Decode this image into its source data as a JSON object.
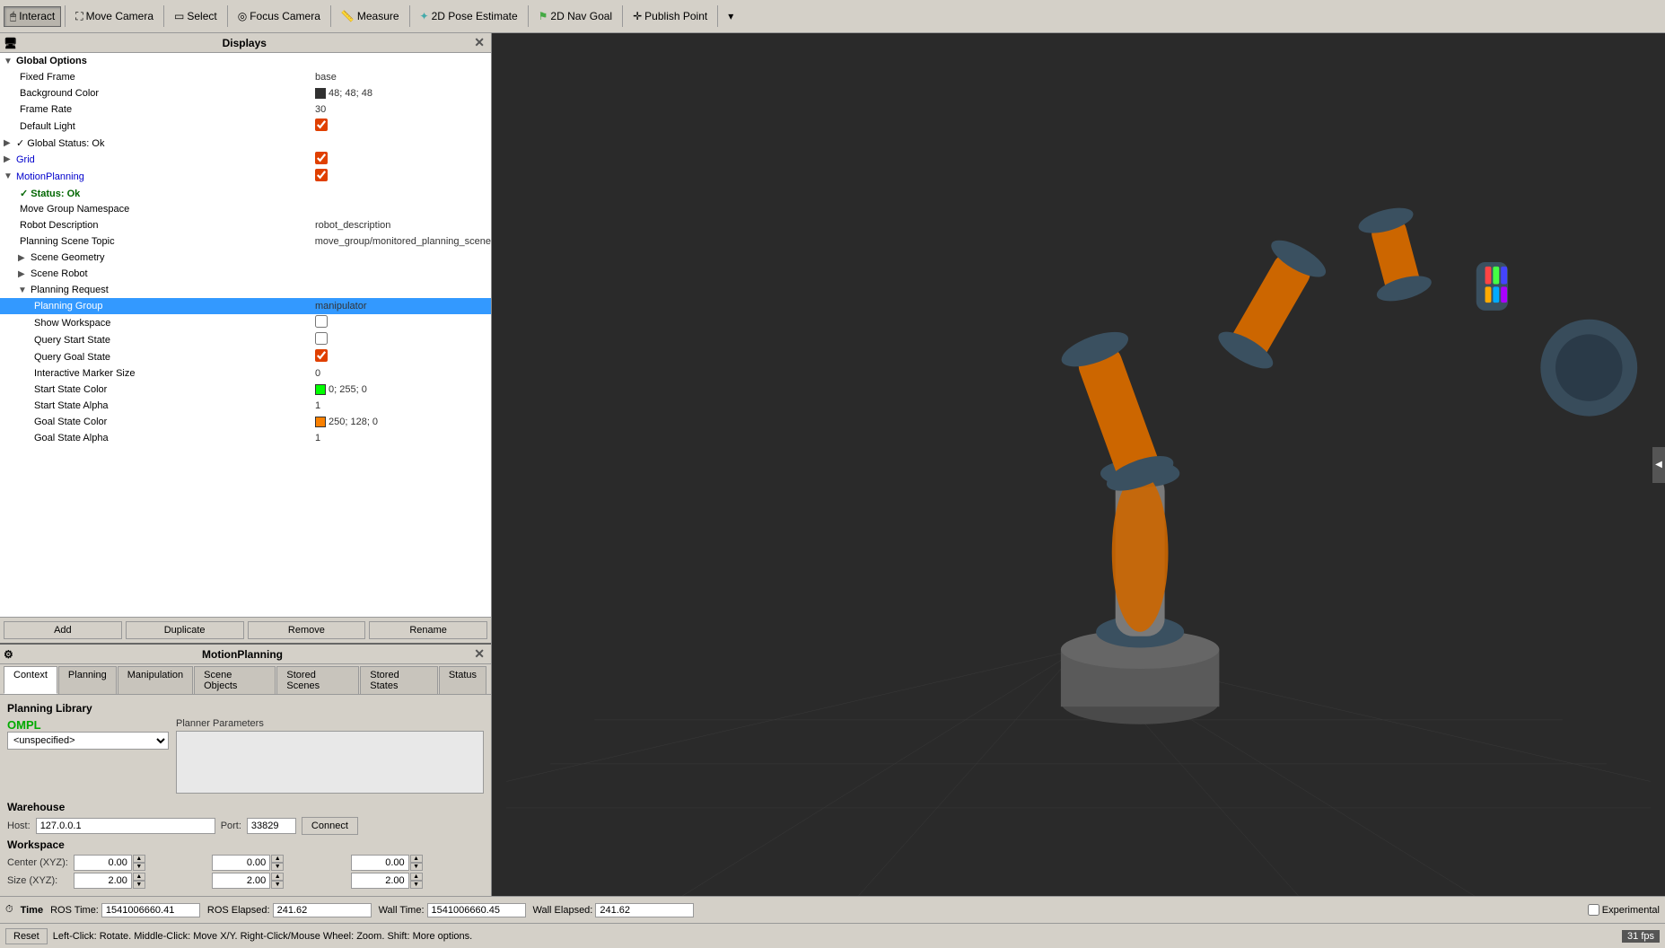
{
  "toolbar": {
    "interact_label": "Interact",
    "move_camera_label": "Move Camera",
    "select_label": "Select",
    "focus_camera_label": "Focus Camera",
    "measure_label": "Measure",
    "pose_estimate_label": "2D Pose Estimate",
    "nav_goal_label": "2D Nav Goal",
    "publish_point_label": "Publish Point"
  },
  "displays": {
    "title": "Displays",
    "items": [
      {
        "indent": 0,
        "expanded": true,
        "label": "Global Options",
        "value": "",
        "type": "section"
      },
      {
        "indent": 1,
        "label": "Fixed Frame",
        "value": "base",
        "type": "text"
      },
      {
        "indent": 1,
        "label": "Background Color",
        "value": "48; 48; 48",
        "type": "color",
        "color": "#303030"
      },
      {
        "indent": 1,
        "label": "Frame Rate",
        "value": "30",
        "type": "text"
      },
      {
        "indent": 1,
        "label": "Default Light",
        "value": "",
        "type": "checkbox",
        "checked": true
      },
      {
        "indent": 0,
        "expanded": false,
        "label": "Global Status: Ok",
        "value": "",
        "type": "section-check"
      },
      {
        "indent": 0,
        "expanded": false,
        "label": "Grid",
        "value": "",
        "type": "section-check",
        "checked": true,
        "color_label": true
      },
      {
        "indent": 0,
        "expanded": true,
        "label": "MotionPlanning",
        "value": "",
        "type": "section-blue",
        "checked": true
      },
      {
        "indent": 1,
        "label": "✓ Status: Ok",
        "value": "",
        "type": "status-ok"
      },
      {
        "indent": 1,
        "label": "Move Group Namespace",
        "value": "",
        "type": "text"
      },
      {
        "indent": 1,
        "label": "Robot Description",
        "value": "robot_description",
        "type": "text"
      },
      {
        "indent": 1,
        "label": "Planning Scene Topic",
        "value": "move_group/monitored_planning_scene",
        "type": "text"
      },
      {
        "indent": 1,
        "label": "Scene Geometry",
        "value": "",
        "type": "section-sub"
      },
      {
        "indent": 1,
        "label": "Scene Robot",
        "value": "",
        "type": "section-sub"
      },
      {
        "indent": 1,
        "expanded": true,
        "label": "Planning Request",
        "value": "",
        "type": "section-sub"
      },
      {
        "indent": 2,
        "label": "Planning Group",
        "value": "manipulator",
        "type": "text",
        "selected": true
      },
      {
        "indent": 2,
        "label": "Show Workspace",
        "value": "",
        "type": "checkbox",
        "checked": false
      },
      {
        "indent": 2,
        "label": "Query Start State",
        "value": "",
        "type": "checkbox",
        "checked": false
      },
      {
        "indent": 2,
        "label": "Query Goal State",
        "value": "",
        "type": "checkbox",
        "checked": true
      },
      {
        "indent": 2,
        "label": "Interactive Marker Size",
        "value": "0",
        "type": "text"
      },
      {
        "indent": 2,
        "label": "Start State Color",
        "value": "0; 255; 0",
        "type": "color",
        "color": "#00ff00"
      },
      {
        "indent": 2,
        "label": "Start State Alpha",
        "value": "1",
        "type": "text"
      },
      {
        "indent": 2,
        "label": "Goal State Color",
        "value": "250; 128; 0",
        "type": "color",
        "color": "#fa8000"
      },
      {
        "indent": 2,
        "label": "Goal State Alpha",
        "value": "1",
        "type": "text"
      }
    ],
    "add_label": "Add",
    "duplicate_label": "Duplicate",
    "remove_label": "Remove",
    "rename_label": "Rename"
  },
  "motion_planning": {
    "title": "MotionPlanning",
    "tabs": [
      "Context",
      "Planning",
      "Manipulation",
      "Scene Objects",
      "Stored Scenes",
      "Stored States",
      "Status"
    ],
    "active_tab": "Context",
    "planning_library": {
      "title": "Planning Library",
      "ompl_label": "OMPL",
      "planner_params_label": "Planner Parameters",
      "planner_value": "<unspecified>"
    },
    "warehouse": {
      "title": "Warehouse",
      "host_label": "Host:",
      "host_value": "127.0.0.1",
      "port_label": "Port:",
      "port_value": "33829",
      "connect_label": "Connect"
    },
    "workspace": {
      "title": "Workspace",
      "center_label": "Center (XYZ):",
      "cx": "0.00",
      "cy": "0.00",
      "cz": "0.00",
      "size_label": "Size (XYZ):",
      "sx": "2.00",
      "sy": "2.00",
      "sz": "2.00"
    }
  },
  "status_bar": {
    "time_label": "Time",
    "ros_time_label": "ROS Time:",
    "ros_time_value": "1541006660.41",
    "ros_elapsed_label": "ROS Elapsed:",
    "ros_elapsed_value": "241.62",
    "wall_time_label": "Wall Time:",
    "wall_time_value": "1541006660.45",
    "wall_elapsed_label": "Wall Elapsed:",
    "wall_elapsed_value": "241.62",
    "experimental_label": "Experimental"
  },
  "bottom_bar": {
    "reset_label": "Reset",
    "hint": "Left-Click: Rotate.  Middle-Click: Move X/Y.  Right-Click/Mouse Wheel: Zoom.  Shift: More options.",
    "fps_label": "31 fps"
  }
}
